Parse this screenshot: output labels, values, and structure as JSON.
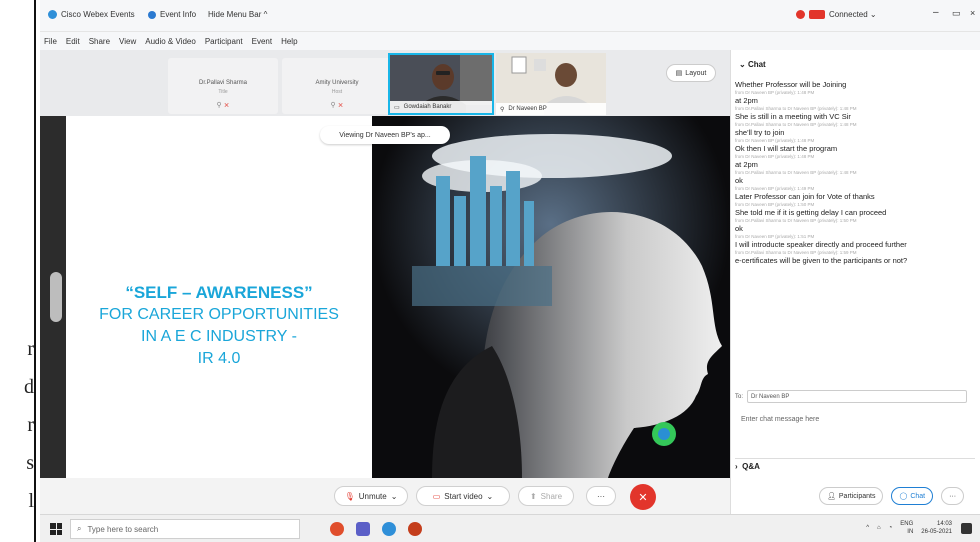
{
  "left_fragments": [
    "r",
    "d",
    "r",
    "s",
    "l"
  ],
  "titlebar": {
    "app_title": "Cisco Webex Events",
    "event_info": "Event Info",
    "hide_menu": "Hide Menu Bar ^",
    "connected": "Connected ⌄"
  },
  "menu": [
    "File",
    "Edit",
    "Share",
    "View",
    "Audio & Video",
    "Participant",
    "Event",
    "Help"
  ],
  "participants": [
    {
      "name": "Dr.Pallavi Sharma",
      "sub": "Title"
    },
    {
      "name": "Amity University",
      "sub": "Host"
    }
  ],
  "video_tiles": [
    {
      "name": "Gowdaiah Banakr"
    },
    {
      "name": "Dr Naveen BP"
    }
  ],
  "layout_label": "Layout",
  "viewing_label": "Viewing Dr Naveen BP's ap...",
  "slide": {
    "line1": "“SELF – AWARENESS”",
    "line2": "FOR  CAREER OPPORTUNITIES",
    "line3": "IN  A E C  INDUSTRY -",
    "line4": "IR 4.0"
  },
  "controls": {
    "unmute": "Unmute",
    "start_video": "Start video",
    "share": "Share",
    "more": "···",
    "end": "✕"
  },
  "chat": {
    "header": "Chat",
    "messages": [
      {
        "text": "Whether Professor will be Joining",
        "meta": "from Dr Naveen BP (privately): 1:48 PM"
      },
      {
        "text": "at 2pm",
        "meta": "from Dr.Pallavi Sharma to Dr Naveen BP (privately): 1:48 PM"
      },
      {
        "text": "She is still in a meeting with VC Sir",
        "meta": "from Dr.Pallavi Sharma to Dr Naveen BP (privately): 1:48 PM"
      },
      {
        "text": "she'll try to join",
        "meta": "from Dr Naveen BP (privately): 1:48 PM"
      },
      {
        "text": "Ok then I will start the program",
        "meta": "from Dr Naveen BP (privately): 1:48 PM"
      },
      {
        "text": "at 2pm",
        "meta": "from Dr.Pallavi Sharma to Dr Naveen BP (privately): 1:48 PM"
      },
      {
        "text": "ok",
        "meta": "from Dr Naveen BP (privately): 1:49 PM"
      },
      {
        "text": "Later Professor can join for Vote of thanks",
        "meta": "from Dr Naveen BP (privately): 1:50 PM"
      },
      {
        "text": "She told me if it is getting delay I can proceed",
        "meta": "from Dr.Pallavi Sharma to Dr Naveen BP (privately): 1:50 PM"
      },
      {
        "text": "ok",
        "meta": "from Dr Naveen BP (privately): 1:51 PM"
      },
      {
        "text": "I will introducte speaker directly and proceed further",
        "meta": "from Dr.Pallavi Sharma to Dr Naveen BP (privately): 1:59 PM"
      },
      {
        "text": "e-certificates will be given to the participants or not?",
        "meta": ""
      }
    ],
    "to_label": "To:",
    "to_value": "Dr Naveen BP",
    "input_placeholder": "Enter chat message here",
    "qa": "Q&A",
    "participants_btn": "Participants",
    "chat_btn": "Chat",
    "more_btn": "···"
  },
  "taskbar": {
    "search_placeholder": "Type here to search",
    "lang": "ENG",
    "region": "IN",
    "time": "14:03",
    "date": "26-05-2021"
  },
  "colors": {
    "accent": "#1aa6d9",
    "end_red": "#e2352b",
    "active_border": "#19b6e8"
  }
}
